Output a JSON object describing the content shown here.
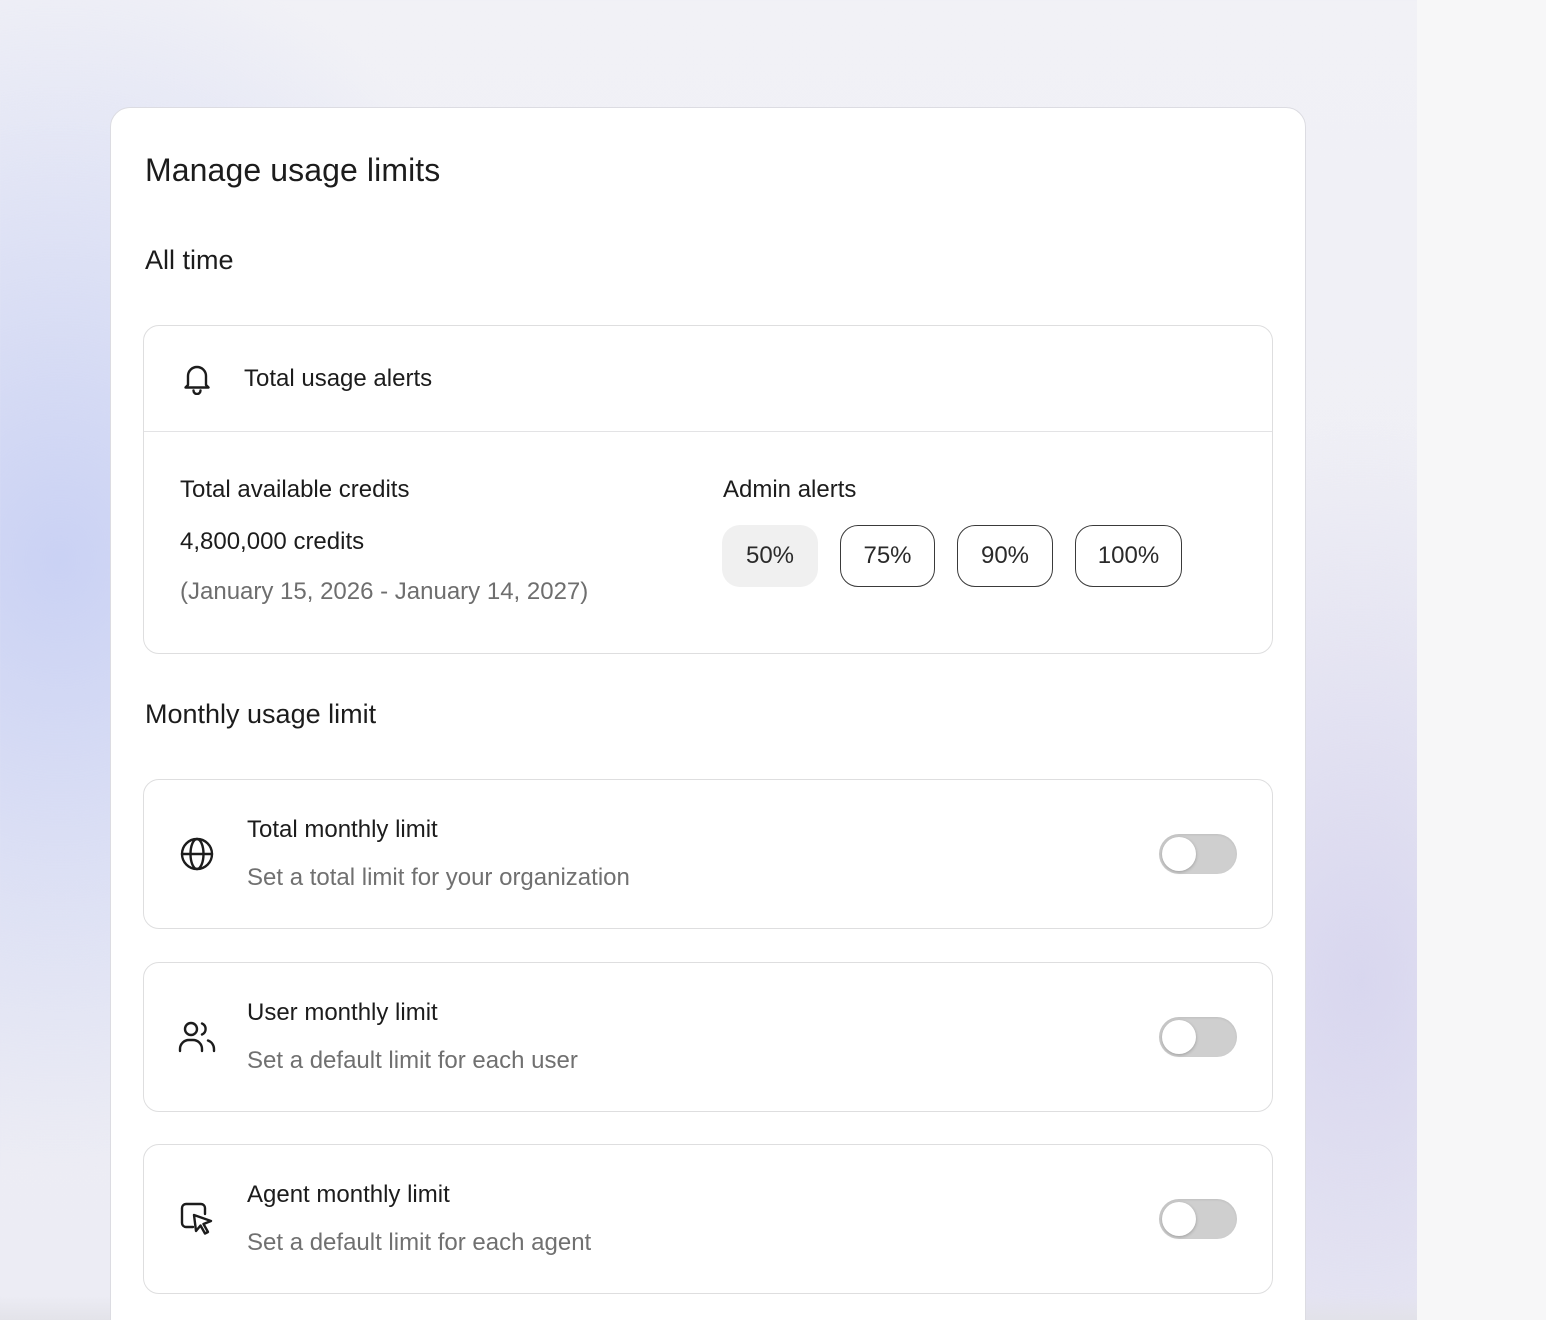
{
  "page": {
    "title": "Manage usage limits"
  },
  "all_time": {
    "section_title": "All time",
    "alerts_header": {
      "icon": "bell-icon",
      "label": "Total usage alerts"
    },
    "credits_label": "Total available credits",
    "credits_value": "4,800,000 credits",
    "credits_range": "(January 15, 2026 - January 14, 2027)",
    "admin_alerts_label": "Admin alerts",
    "admin_alert_options": [
      {
        "label": "50%",
        "selected": true
      },
      {
        "label": "75%",
        "selected": false
      },
      {
        "label": "90%",
        "selected": false
      },
      {
        "label": "100%",
        "selected": false
      }
    ]
  },
  "monthly": {
    "section_title": "Monthly usage limit",
    "limits": [
      {
        "icon": "globe-icon",
        "title": "Total monthly limit",
        "subtitle": "Set a total limit for your organization",
        "enabled": false
      },
      {
        "icon": "users-icon",
        "title": "User monthly limit",
        "subtitle": "Set a default limit for each user",
        "enabled": false
      },
      {
        "icon": "agent-cursor-icon",
        "title": "Agent monthly limit",
        "subtitle": "Set a default limit for each agent",
        "enabled": false
      }
    ]
  },
  "colors": {
    "toggle_off": "#cfcfcf",
    "chip_selected_bg": "#f0f0f0",
    "chip_border": "#3a3a3a",
    "muted_text": "#6e6e6e"
  }
}
